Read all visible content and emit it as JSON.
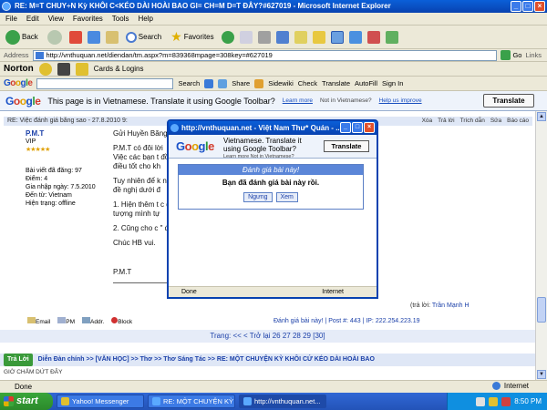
{
  "window": {
    "title": "RE: M=T CHUY÷N Kỳ KHÔI C<KÉO DÀI HOÀI BAO GI= CH=M D=T ĐÂY?#627019 - Microsoft Internet Explorer"
  },
  "menu": [
    "File",
    "Edit",
    "View",
    "Favorites",
    "Tools",
    "Help"
  ],
  "toolbar": {
    "back": "Back",
    "search": "Search",
    "favorites": "Favorites"
  },
  "address": {
    "label": "Address",
    "url": "http://vnthuquan.net/diendan/tm.aspx?m=839368mpage=308key=#627019",
    "go": "Go",
    "links": "Links"
  },
  "norton": {
    "brand": "Norton",
    "cards": "Cards & Logins"
  },
  "googlebar": {
    "search": "Search",
    "share": "Share",
    "sidewiki": "Sidewiki",
    "check": "Check",
    "translate": "Translate",
    "autofill": "AutoFill",
    "signin": "Sign In"
  },
  "translatebar": {
    "message": "This page is in Vietnamese.  Translate it using Google Toolbar?",
    "learn_more": "Learn more",
    "not_vi": "Not in Vietnamese?",
    "help_improve": "Help us improve",
    "button": "Translate"
  },
  "post": {
    "header": "RE: Việc đánh giá bằng sao - 27.8.2010 9:",
    "actions": [
      "Xóa",
      "Trả lời",
      "Trích dẫn",
      "Sửa",
      "Báo cáo"
    ],
    "username": "P.M.T",
    "rank": "VIP",
    "stars": "★★★★★",
    "stats": [
      "Bài viết đã đăng: 97",
      "Điểm: 4",
      "Gia nhập ngày: 7.5.2010",
      "Đến từ: Vietnam",
      "Hiện trạng: offline"
    ],
    "body": [
      "Gửi Huyền Băng",
      "P.M.T có đôi lời",
      "Việc các bạn t                                        đồng cảm của mình với bài đăng của bạn th",
      "điều tốt cho kh",
      "Tuy nhiên để k                                        nh Hùng, có lẽ HB và Ban quản trị thử xem",
      "đề nghị dưới đ",
      "1. Hiện thêm t                                        c đánh giá. Việc làm này sẽ ngăn chặn hiện",
      "tượng mình tự",
      "2. Cũng cho c                                        \" đánh giá trước đó.",
      "Chúc HB vui.",
      "P.M.T"
    ],
    "replied_by_prefix": "(trả lời:",
    "replied_by": "Trần Mạnh H",
    "footer_actions": [
      "Email",
      "PM",
      "Addr.",
      "Block"
    ],
    "footer_info": "Đánh giá bài này! | Post #: 443 | IP: 222.254.223.19"
  },
  "pagination": "Trang:  <<  < Trở lại  26 27 28 29 [30]",
  "breadcrumb": {
    "reply": "Trả Lời",
    "path": "Diễn Đàn chính >> [VĂN HỌC] >> Thơ >> Thơ Sáng Tác >> RE: MỘT CHUYỆN KỲ KHÔI CỨ KÉO DÀI HOÀI BAO",
    "tail": "GIỜ CHẤM DỨT ĐÂY"
  },
  "status": {
    "text": "Done",
    "zone": "Internet"
  },
  "popup": {
    "title": "http://vnthuquan.net - Việt Nam Thư* Quán - ...",
    "trans_line1": "Vietnamese.  Translate it",
    "trans_line2": "using Google Toolbar?",
    "trans_small": "Learn more  Not in Vietnamese?",
    "trans_button": "Translate",
    "dialog_title": "Đánh giá bài này!",
    "dialog_message": "Bạn đã đánh giá bài này rồi.",
    "btn_stop": "Ngưng",
    "btn_view": "Xem",
    "status": "Done",
    "zone": "Internet"
  },
  "taskbar": {
    "start": "start",
    "items": [
      "Yahoo! Messenger",
      "RE: MỘT CHUYỆN KỲ ...",
      "http://vnthuquan.net..."
    ],
    "clock": "8:50 PM"
  }
}
